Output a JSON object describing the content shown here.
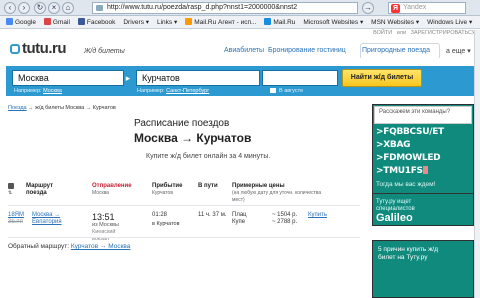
{
  "browser": {
    "url": "http://www.tutu.ru/poezda/rasp_d.php?nnst1=2000000&nnst2",
    "search_placeholder": "Yandex",
    "bookmarks": [
      "Google",
      "Gmail",
      "Facebook",
      "Drivers",
      "Links",
      "Mail.Ru Агент - исп...",
      "Mail.Ru",
      "Microsoft Websites",
      "MSN Websites",
      "Windows Live"
    ]
  },
  "header": {
    "login": "ВОЙТИ",
    "or": "или",
    "register": "ЗАРЕГИСТРИРОВАТЬСЯ",
    "logo": "tutu.ru",
    "logo_sub": "Ж/д билеты",
    "nav": [
      "Авиабилеты",
      "Бронирование гостиниц",
      "Пригородные поезда"
    ],
    "nav_more": "а еще"
  },
  "search": {
    "from": "Москва",
    "to": "Курчатов",
    "from_hint": "Например:",
    "from_hint_link": "Москва",
    "to_hint": "Например:",
    "to_hint_link": "Санкт-Петербург",
    "date_hint": "В августе",
    "button": "Найти ж/д билеты"
  },
  "breadcrumb": {
    "link": "Поезда",
    "rest": "→ ж/д билеты Москва → Курчатов"
  },
  "main": {
    "title": "Расписание поездов",
    "route": "Москва → Курчатов",
    "subtitle": "Купите ж/д билет онлайн за 4 минуты."
  },
  "table": {
    "headers": {
      "train": "Маршрут поезда",
      "departure": "Отправление",
      "departure_sub": "Москва",
      "arrival": "Прибытие",
      "arrival_sub": "Курчатов",
      "duration": "В пути",
      "prices": "Примерные цены",
      "prices_sub": "(на любую дату для уточн. количества мест)"
    },
    "rows": [
      {
        "train_no": "18ЯМ",
        "train_no2": "3b.пп",
        "route_link1": "Москва →",
        "route_link2": "Евпатория",
        "dep_time": "13:51",
        "dep_note1": "из Москвы",
        "dep_note2": "Киевский",
        "dep_note3": "вокзал",
        "arr_time": "01:28",
        "arr_note": "в Курчатов",
        "duration": "11 ч. 37 м.",
        "class1": "Плац",
        "class2": "Купе",
        "price1": "~ 1504 р.",
        "price2": "~ 2788 р.",
        "buy": "Купить"
      }
    ]
  },
  "return_route": {
    "label": "Обратный маршрут:",
    "link": "Курчатов → Москва"
  },
  "ad": {
    "top": "Расскажем эти команды?",
    "commands": [
      ">FQBBCSU/ET",
      ">XBAG",
      ">FDMOWLED",
      ">TMU1FS"
    ],
    "welcome": "Тогда мы вас ждем!",
    "line1": "Туту.ру ищет",
    "line2": "специалистов",
    "brand": "Galileo",
    "ad2_line1": "5 причин купить ж/д",
    "ad2_line2": "билет на Туту.ру"
  },
  "colors": {
    "accent": "#2c99d1",
    "button": "#f8c61f",
    "ad_bg": "#0f8a7d",
    "link": "#2a73b8"
  }
}
